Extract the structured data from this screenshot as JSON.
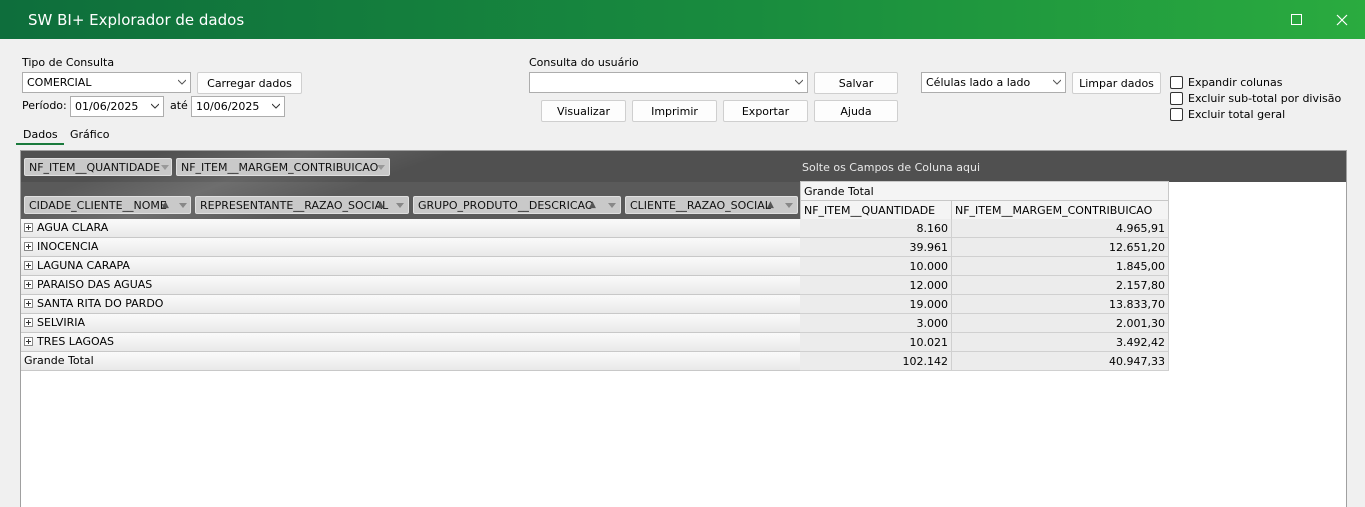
{
  "window": {
    "title": "SW BI+ Explorador de dados"
  },
  "toolbar": {
    "tipo_consulta_label": "Tipo de Consulta",
    "tipo_consulta_value": "COMERCIAL",
    "carregar_label": "Carregar dados",
    "periodo_label": "Período:",
    "periodo_inicio": "01/06/2025",
    "ate_label": "até",
    "periodo_fim": "10/06/2025",
    "consulta_usuario_label": "Consulta do usuário",
    "consulta_usuario_value": "",
    "salvar_label": "Salvar",
    "visualizar_label": "Visualizar",
    "imprimir_label": "Imprimir",
    "exportar_label": "Exportar",
    "ajuda_label": "Ajuda",
    "layout_value": "Células lado a lado",
    "limpar_label": "Limpar dados",
    "options": [
      {
        "label": "Expandir colunas",
        "checked": false
      },
      {
        "label": "Excluir sub-total por divisão",
        "checked": false
      },
      {
        "label": "Excluir total geral",
        "checked": false
      }
    ]
  },
  "tabs": [
    {
      "label": "Dados",
      "active": true
    },
    {
      "label": "Gráfico",
      "active": false
    }
  ],
  "pivot": {
    "data_fields": [
      "NF_ITEM__QUANTIDADE",
      "NF_ITEM__MARGEM_CONTRIBUICAO"
    ],
    "column_drop_text": "Solte os Campos de Coluna aqui",
    "row_fields": [
      "CIDADE_CLIENTE__NOME",
      "REPRESENTANTE__RAZAO_SOCIAL",
      "GRUPO_PRODUTO__DESCRICAO",
      "CLIENTE__RAZAO_SOCIAL"
    ],
    "grand_total_header": "Grande Total",
    "value_headers": [
      "NF_ITEM__QUANTIDADE",
      "NF_ITEM__MARGEM_CONTRIBUICAO"
    ],
    "rows": [
      {
        "label": "AGUA CLARA",
        "quantidade": "8.160",
        "margem": "4.965,91"
      },
      {
        "label": "INOCENCIA",
        "quantidade": "39.961",
        "margem": "12.651,20"
      },
      {
        "label": "LAGUNA CARAPA",
        "quantidade": "10.000",
        "margem": "1.845,00"
      },
      {
        "label": "PARAISO DAS AGUAS",
        "quantidade": "12.000",
        "margem": "2.157,80"
      },
      {
        "label": "SANTA RITA DO PARDO",
        "quantidade": "19.000",
        "margem": "13.833,70"
      },
      {
        "label": "SELVIRIA",
        "quantidade": "3.000",
        "margem": "2.001,30"
      },
      {
        "label": "TRES LAGOAS",
        "quantidade": "10.021",
        "margem": "3.492,42"
      }
    ],
    "total": {
      "label": "Grande Total",
      "quantidade": "102.142",
      "margem": "40.947,33"
    }
  }
}
